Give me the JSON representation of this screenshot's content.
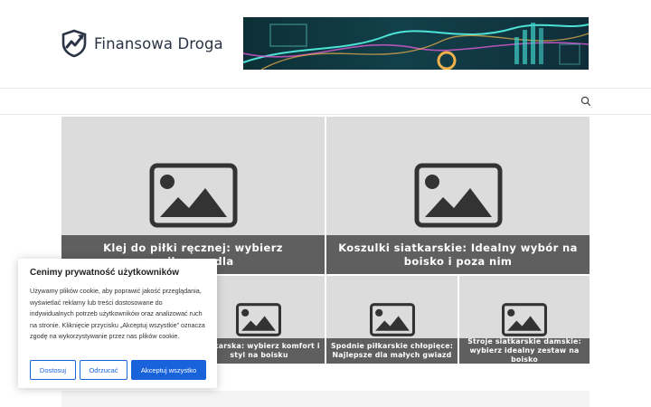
{
  "site": {
    "name": "Finansowa Droga"
  },
  "nav": {
    "search_icon": "search-icon"
  },
  "colors": {
    "accent": "#1863dc",
    "logo_dark": "#2b3445",
    "caption_bg": "#555555",
    "placeholder_bg": "#dcdcdc"
  },
  "posts": {
    "big": [
      {
        "title": "Klej do piłki ręcznej: wybierz najlepszy dla"
      },
      {
        "title": "Koszulki siatkarskie: Idealny wybór na boisko i poza nim"
      }
    ],
    "small": [
      {
        "title": "siatkarska: wybierz komfort i styl na boisku"
      },
      {
        "title": "Spodnie piłkarskie chłopięce: Najlepsze dla małych gwiazd"
      },
      {
        "title": "Stroje siatkarskie damskie: wybierz idealny zestaw na boisko"
      }
    ]
  },
  "cookie": {
    "title": "Cenimy prywatność użytkowników",
    "text": "Używamy plików cookie, aby poprawić jakość przeglądania, wyświetlać reklamy lub treści dostosowane do indywidualnych potrzeb użytkowników oraz analizować ruch na stronie. Kliknięcie przycisku „Akceptuj wszystkie” oznacza zgodę na wykorzystywanie przez nas plików cookie.",
    "customize_label": "Dostosuj",
    "reject_label": "Odrzucać",
    "accept_label": "Akceptuj wszystko"
  }
}
